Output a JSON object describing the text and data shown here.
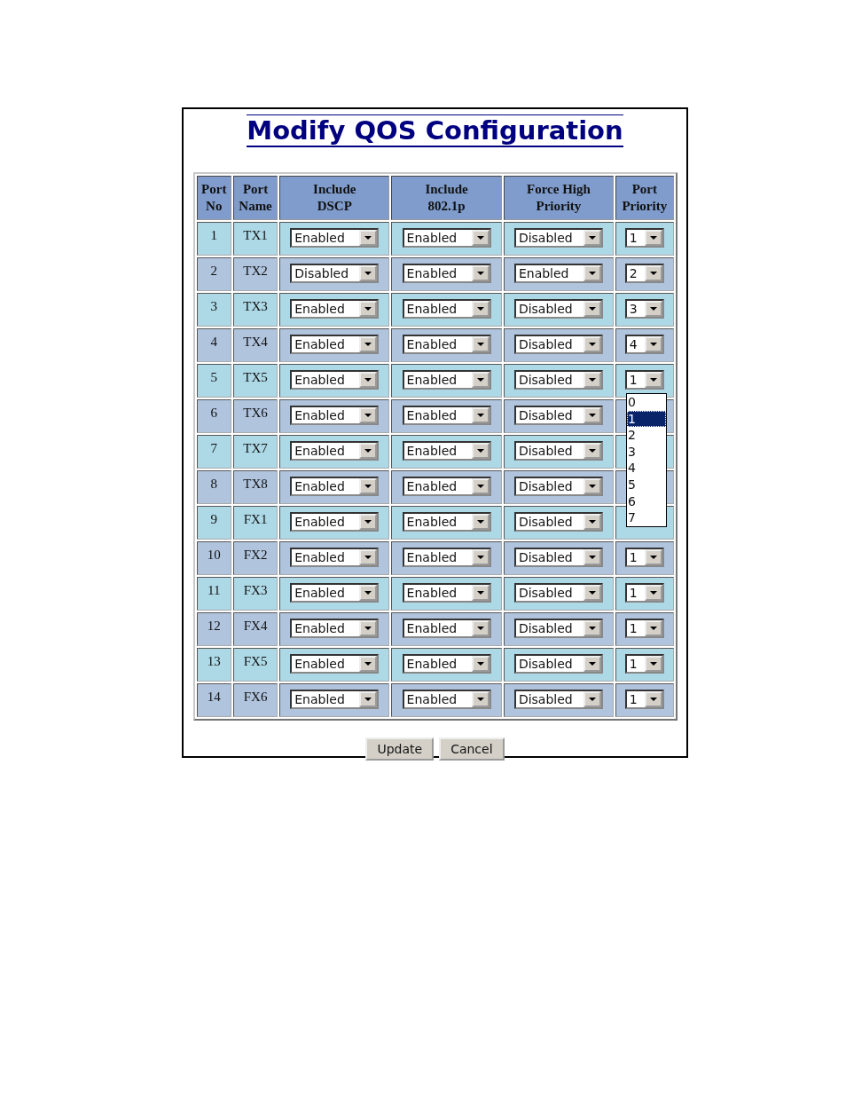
{
  "title": "Modify QOS Configuration",
  "columns": [
    {
      "line1": "Port",
      "line2": "No"
    },
    {
      "line1": "Port",
      "line2": "Name"
    },
    {
      "line1": "Include",
      "line2": "DSCP"
    },
    {
      "line1": "Include",
      "line2": "802.1p"
    },
    {
      "line1": "Force High",
      "line2": "Priority"
    },
    {
      "line1": "Port",
      "line2": "Priority"
    }
  ],
  "rows": [
    {
      "port_no": "1",
      "port_name": "TX1",
      "dscp": "Enabled",
      "dot1p": "Enabled",
      "force_high": "Disabled",
      "priority": "1"
    },
    {
      "port_no": "2",
      "port_name": "TX2",
      "dscp": "Disabled",
      "dot1p": "Enabled",
      "force_high": "Enabled",
      "priority": "2"
    },
    {
      "port_no": "3",
      "port_name": "TX3",
      "dscp": "Enabled",
      "dot1p": "Enabled",
      "force_high": "Disabled",
      "priority": "3"
    },
    {
      "port_no": "4",
      "port_name": "TX4",
      "dscp": "Enabled",
      "dot1p": "Enabled",
      "force_high": "Disabled",
      "priority": "4"
    },
    {
      "port_no": "5",
      "port_name": "TX5",
      "dscp": "Enabled",
      "dot1p": "Enabled",
      "force_high": "Disabled",
      "priority": "1",
      "priority_menu": [
        {
          "label": "0",
          "selected": false
        },
        {
          "label": "1",
          "selected": true
        },
        {
          "label": "2",
          "selected": false
        },
        {
          "label": "3",
          "selected": false
        },
        {
          "label": "4",
          "selected": false
        },
        {
          "label": "5",
          "selected": false
        },
        {
          "label": "6",
          "selected": false
        },
        {
          "label": "7",
          "selected": false
        }
      ]
    },
    {
      "port_no": "6",
      "port_name": "TX6",
      "dscp": "Enabled",
      "dot1p": "Enabled",
      "force_high": "Disabled"
    },
    {
      "port_no": "7",
      "port_name": "TX7",
      "dscp": "Enabled",
      "dot1p": "Enabled",
      "force_high": "Disabled"
    },
    {
      "port_no": "8",
      "port_name": "TX8",
      "dscp": "Enabled",
      "dot1p": "Enabled",
      "force_high": "Disabled"
    },
    {
      "port_no": "9",
      "port_name": "FX1",
      "dscp": "Enabled",
      "dot1p": "Enabled",
      "force_high": "Disabled"
    },
    {
      "port_no": "10",
      "port_name": "FX2",
      "dscp": "Enabled",
      "dot1p": "Enabled",
      "force_high": "Disabled",
      "priority": "1"
    },
    {
      "port_no": "11",
      "port_name": "FX3",
      "dscp": "Enabled",
      "dot1p": "Enabled",
      "force_high": "Disabled",
      "priority": "1"
    },
    {
      "port_no": "12",
      "port_name": "FX4",
      "dscp": "Enabled",
      "dot1p": "Enabled",
      "force_high": "Disabled",
      "priority": "1"
    },
    {
      "port_no": "13",
      "port_name": "FX5",
      "dscp": "Enabled",
      "dot1p": "Enabled",
      "force_high": "Disabled",
      "priority": "1"
    },
    {
      "port_no": "14",
      "port_name": "FX6",
      "dscp": "Enabled",
      "dot1p": "Enabled",
      "force_high": "Disabled",
      "priority": "1"
    }
  ],
  "buttons": [
    "Update",
    "Cancel"
  ]
}
